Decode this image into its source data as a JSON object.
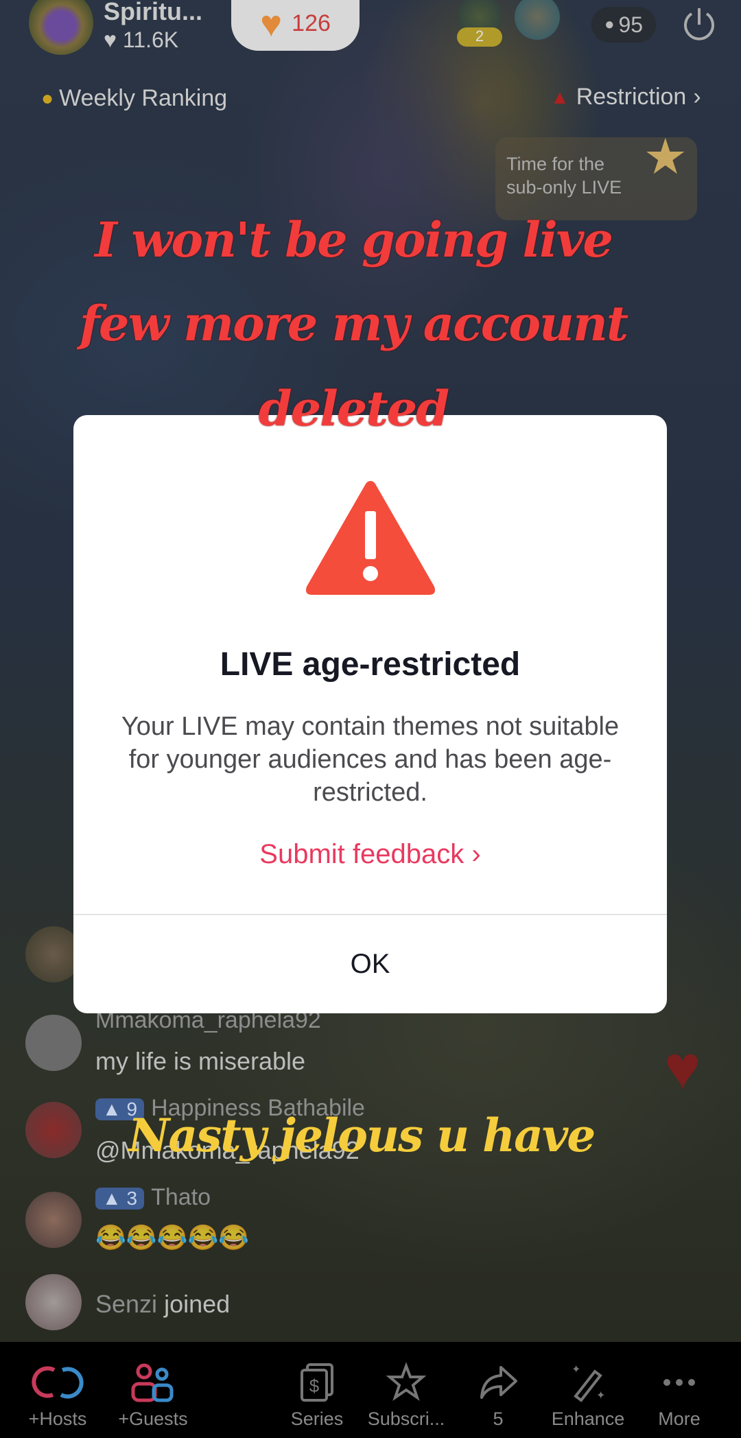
{
  "host": {
    "name": "Spiritu...",
    "likes": "11.6K"
  },
  "gift_counter": {
    "value": "126",
    "icon": "heart-icon"
  },
  "guests": [
    {
      "badge": "2"
    },
    {
      "badge": ""
    }
  ],
  "viewer_count": "95",
  "weekly_ranking_label": "Weekly Ranking",
  "restriction_label": "Restriction",
  "sub_only_card": {
    "line1": "Time for the",
    "line2": "sub-only LIVE"
  },
  "overlay_text": {
    "red_lines": [
      "I won't be going live",
      "few more my account",
      "deleted"
    ],
    "yellow": "Nasty jelous u have",
    "red_color": "#f23c3c",
    "yellow_color": "#f5cd3c"
  },
  "dialog": {
    "title": "LIVE age-restricted",
    "body": "Your LIVE may contain themes not suitable for younger audiences and has been age-restricted.",
    "feedback_link": "Submit feedback",
    "ok_label": "OK",
    "warning_color": "#f44d3c",
    "link_color": "#e9395f"
  },
  "chat": [
    {
      "name": "Mmakoma_raphela92",
      "text": "my life  is miserable"
    },
    {
      "level": "9",
      "name": "Happiness Bathabile",
      "text": "@Mmakoma_raphela92"
    },
    {
      "level": "3",
      "name": "Thato",
      "text": "😂😂😂😂😂"
    },
    {
      "name": "Senzi",
      "text": "joined"
    }
  ],
  "bottom_nav": [
    {
      "label": "+Hosts",
      "icon": "link-hosts-icon"
    },
    {
      "label": "+Guests",
      "icon": "guests-icon"
    },
    {
      "label": "Series",
      "icon": "series-dollar-icon"
    },
    {
      "label": "Subscri...",
      "icon": "subscribe-star-icon"
    },
    {
      "label": "5",
      "icon": "share-arrow-icon"
    },
    {
      "label": "Enhance",
      "icon": "magic-wand-icon"
    },
    {
      "label": "More",
      "icon": "more-dots-icon"
    }
  ]
}
